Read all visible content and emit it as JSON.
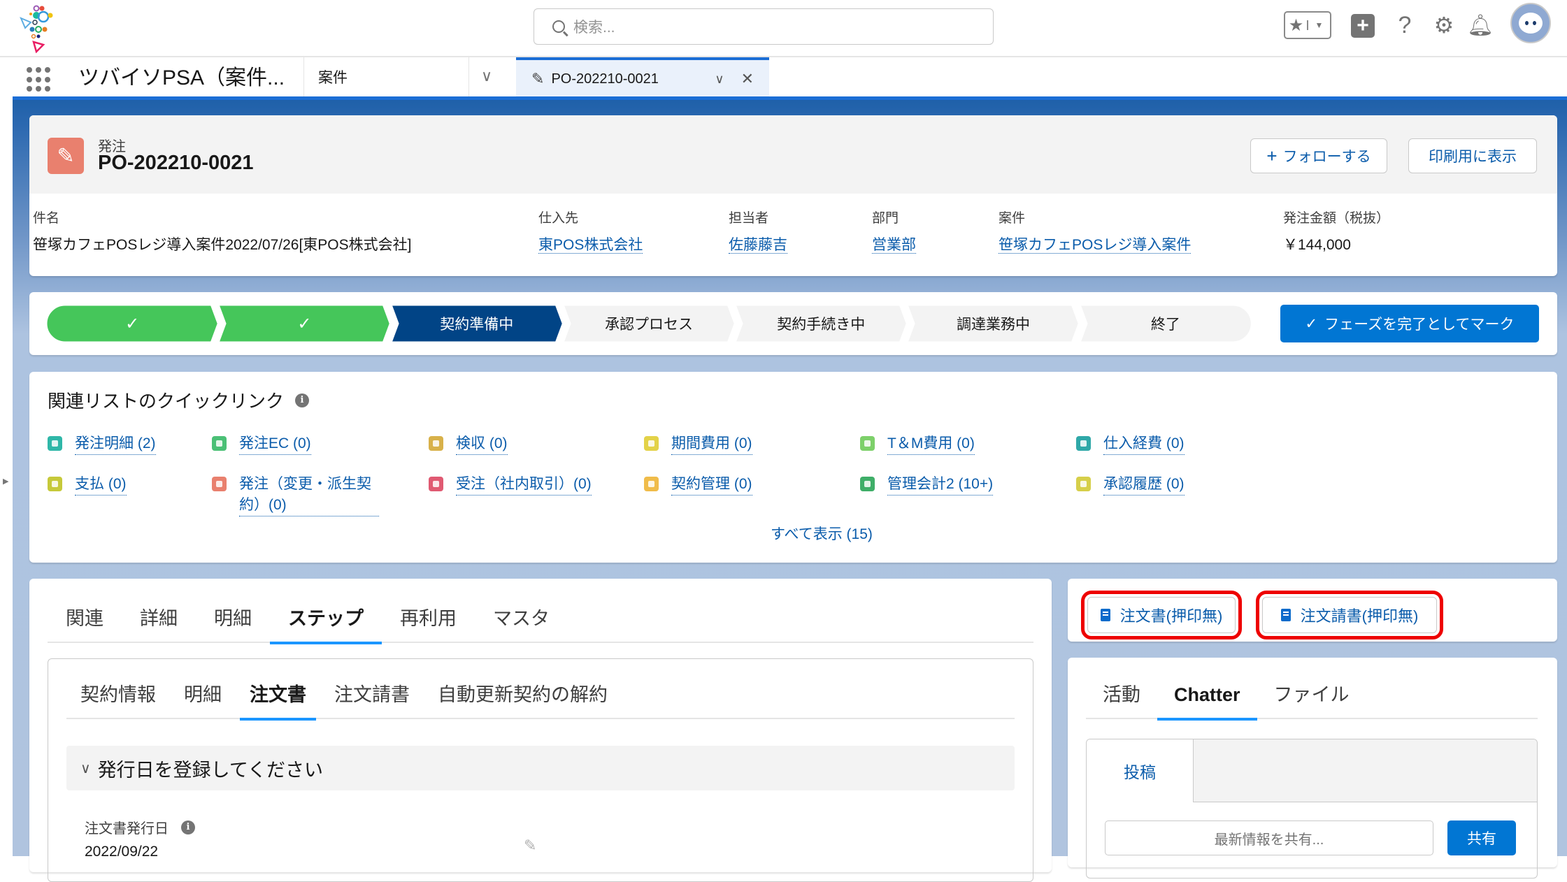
{
  "search": {
    "placeholder": "検索..."
  },
  "utility": {
    "favorites_icon": "star-icon",
    "add_icon": "plus-icon",
    "help": "?",
    "settings_icon": "gear-icon",
    "notifications_icon": "bell-icon"
  },
  "nav": {
    "app_name": "ツバイソPSA（案件...",
    "object_item": "案件",
    "tab": {
      "label": "PO-202210-0021"
    }
  },
  "record": {
    "type": "発注",
    "name": "PO-202210-0021",
    "follow_label": "フォローする",
    "print_label": "印刷用に表示",
    "fields": [
      {
        "label": "件名",
        "value": "笹塚カフェPOSレジ導入案件2022/07/26[東POS株式会社]",
        "link": false
      },
      {
        "label": "仕入先",
        "value": "東POS株式会社",
        "link": true
      },
      {
        "label": "担当者",
        "value": "佐藤藤吉",
        "link": true
      },
      {
        "label": "部門",
        "value": "営業部",
        "link": true
      },
      {
        "label": "案件",
        "value": "笹塚カフェPOSレジ導入案件",
        "link": true
      },
      {
        "label": "発注金額（税抜）",
        "value": "￥144,000",
        "link": false
      }
    ]
  },
  "path": {
    "steps": [
      {
        "label": "✓",
        "state": "done"
      },
      {
        "label": "✓",
        "state": "done"
      },
      {
        "label": "契約準備中",
        "state": "current"
      },
      {
        "label": "承認プロセス",
        "state": "todo"
      },
      {
        "label": "契約手続き中",
        "state": "todo"
      },
      {
        "label": "調達業務中",
        "state": "todo"
      },
      {
        "label": "終了",
        "state": "todo"
      }
    ],
    "mark_complete_label": "フェーズを完了としてマーク",
    "colors": {
      "done": "#45c65a",
      "current": "#014486",
      "todo": "#f3f3f3",
      "button": "#0176d3"
    }
  },
  "quick_links": {
    "title": "関連リストのクイックリンク",
    "items": [
      {
        "label": "発注明細 (2)",
        "color": "#2fb7a8"
      },
      {
        "label": "発注EC (0)",
        "color": "#4bc076"
      },
      {
        "label": "検収 (0)",
        "color": "#d8b14a"
      },
      {
        "label": "期間費用 (0)",
        "color": "#e3d248"
      },
      {
        "label": "T＆M費用 (0)",
        "color": "#7dd06a"
      },
      {
        "label": "仕入経費 (0)",
        "color": "#2fa8a8"
      },
      {
        "label": "支払 (0)",
        "color": "#c6c93a"
      },
      {
        "label": "発注（変更・派生契約）(0)",
        "color": "#e9806e"
      },
      {
        "label": "受注（社内取引）(0)",
        "color": "#e05a72"
      },
      {
        "label": "契約管理 (0)",
        "color": "#f0bc4a"
      },
      {
        "label": "管理会計2 (10+)",
        "color": "#3fae68"
      },
      {
        "label": "承認履歴 (0)",
        "color": "#d6cf4a"
      }
    ],
    "show_all": "すべて表示 (15)"
  },
  "main_tabs": {
    "tabs": [
      "関連",
      "詳細",
      "明細",
      "ステップ",
      "再利用",
      "マスタ"
    ],
    "active": "ステップ",
    "sub_tabs": [
      "契約情報",
      "明細",
      "注文書",
      "注文請書",
      "自動更新契約の解約"
    ],
    "sub_active": "注文書",
    "section_title": "発行日を登録してください",
    "field_label": "注文書発行日",
    "field_value": "2022/09/22"
  },
  "actions": {
    "order_doc": "注文書(押印無)",
    "order_ack_doc": "注文請書(押印無)",
    "highlight_color": "#ee0000"
  },
  "side_tabs": {
    "tabs": [
      "活動",
      "Chatter",
      "ファイル"
    ],
    "active": "Chatter",
    "publisher_tab": "投稿",
    "share_placeholder": "最新情報を共有...",
    "share_button": "共有"
  }
}
